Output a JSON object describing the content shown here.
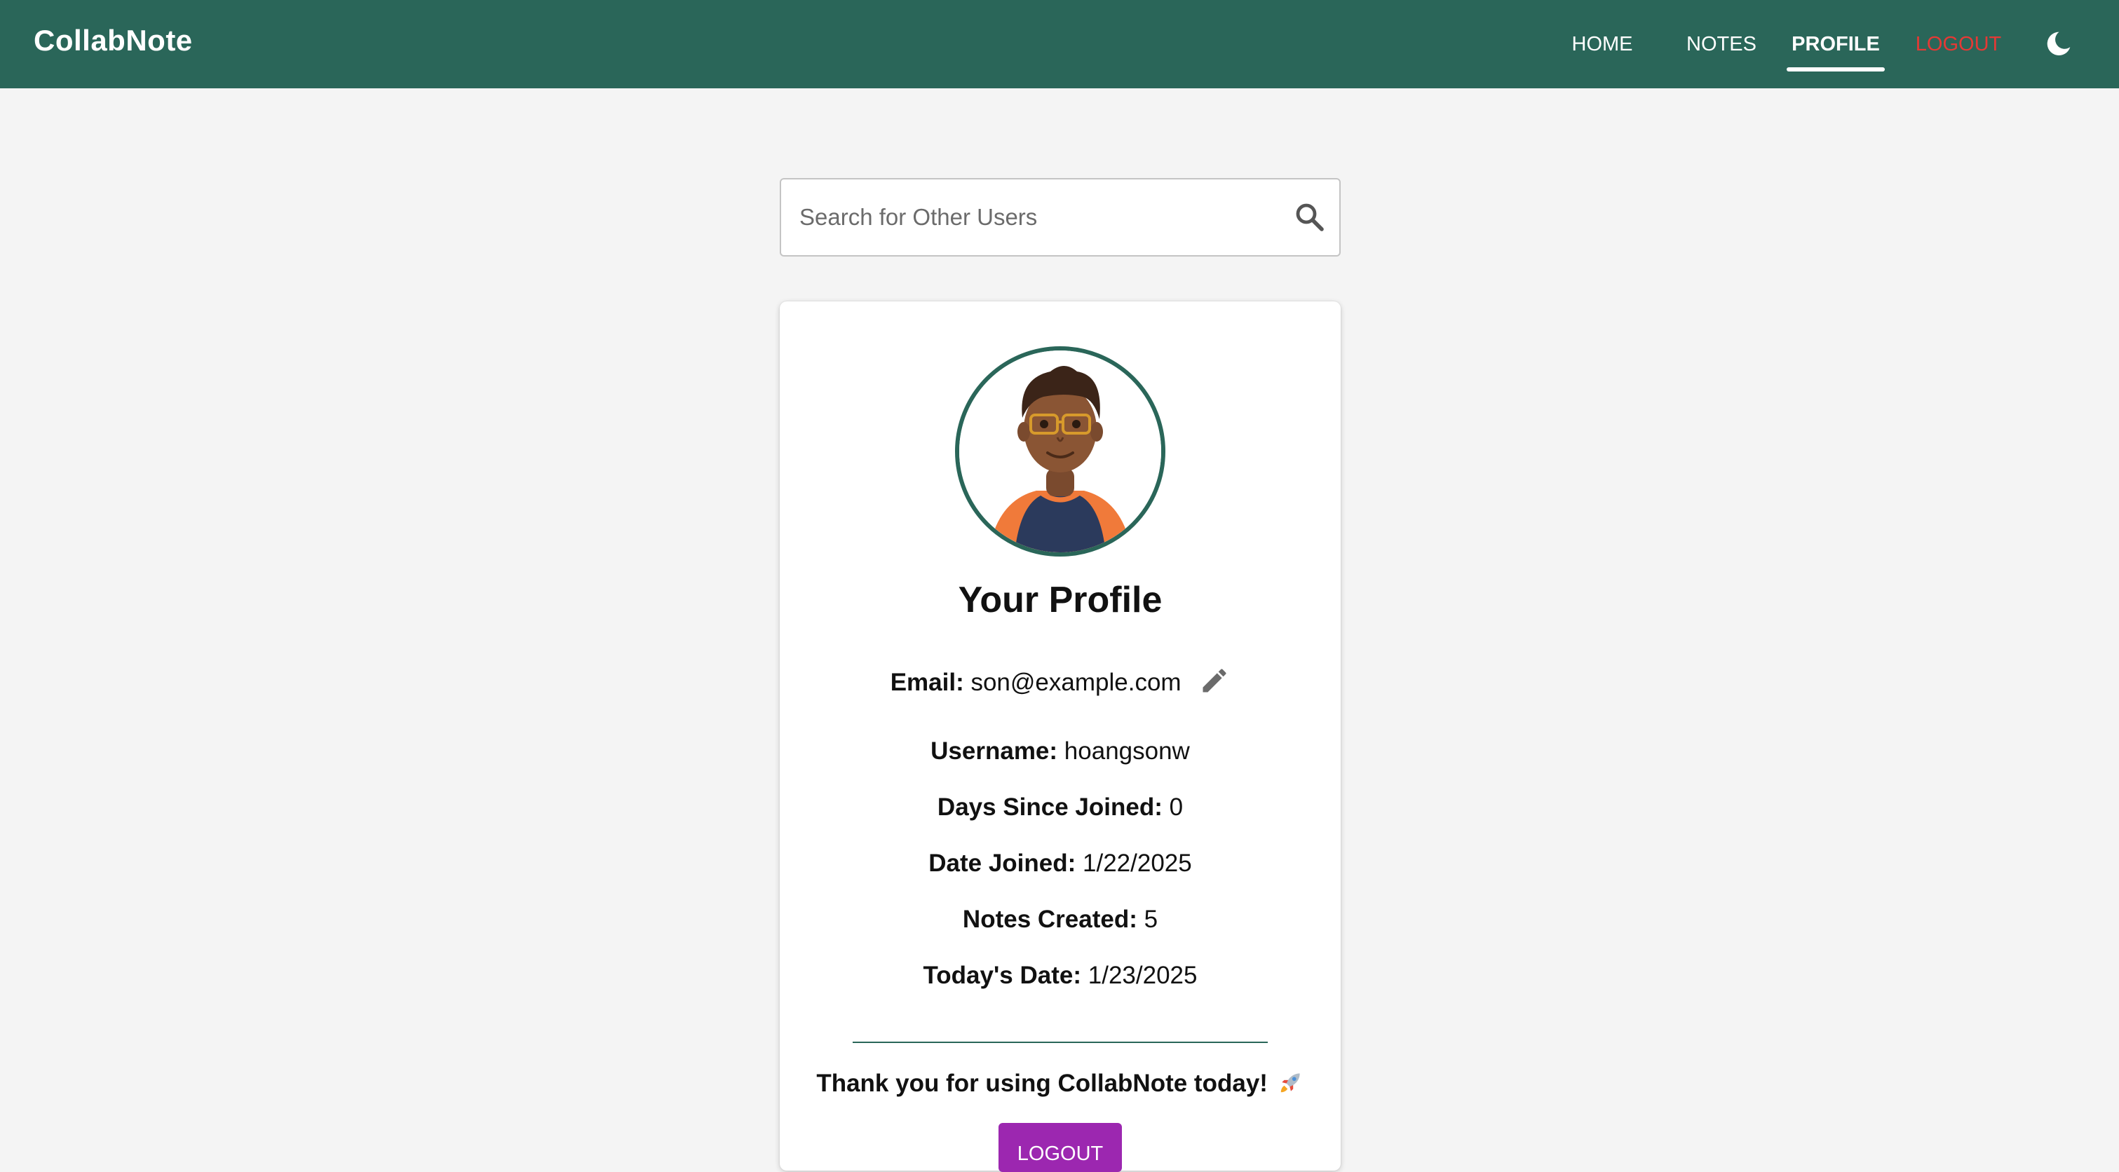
{
  "app": {
    "name": "CollabNote"
  },
  "nav": {
    "items": [
      {
        "label": "HOME"
      },
      {
        "label": "NOTES"
      },
      {
        "label": "PROFILE",
        "active": true
      },
      {
        "label": "LOGOUT"
      }
    ],
    "theme_toggle_icon": "moon-icon"
  },
  "search": {
    "placeholder": "Search for Other Users",
    "icon": "search-icon"
  },
  "profile": {
    "title": "Your Profile",
    "avatar_icon": "memoji-avatar",
    "email": {
      "label": "Email:",
      "value": "son@example.com"
    },
    "username": {
      "label": "Username:",
      "value": "hoangsonw"
    },
    "days_since_joined": {
      "label": "Days Since Joined:",
      "value": "0"
    },
    "date_joined": {
      "label": "Date Joined:",
      "value": "1/22/2025"
    },
    "notes_created": {
      "label": "Notes Created:",
      "value": "5"
    },
    "todays_date": {
      "label": "Today's Date:",
      "value": "1/23/2025"
    },
    "thanks_message": "Thank you for using CollabNote today!",
    "logout_button": "LOGOUT"
  },
  "colors": {
    "header": "#2a6659",
    "logout_link": "#e53935",
    "logout_button": "#9c27b0",
    "background": "#f4f4f4"
  }
}
